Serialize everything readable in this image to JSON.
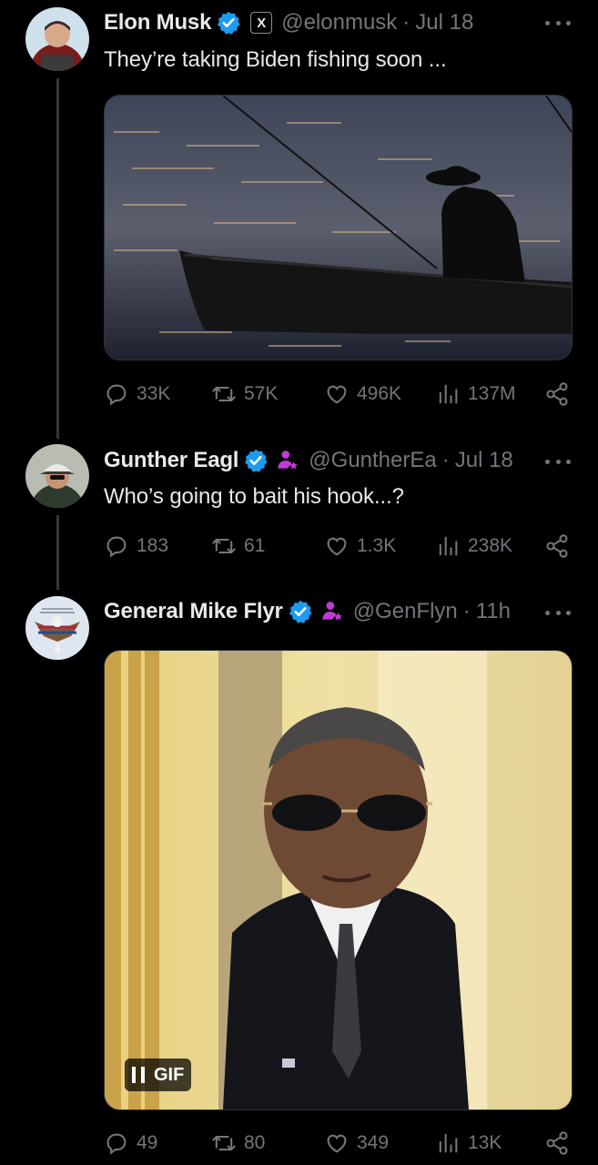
{
  "tweets": [
    {
      "author": "Elon Musk",
      "handle": "@elonmusk",
      "sep": "·",
      "time": "Jul 18",
      "text": "They’re taking Biden fishing soon ...",
      "badge_icon": "x-logo-icon",
      "stats": {
        "replies": "33K",
        "reposts": "57K",
        "likes": "496K",
        "views": "137M"
      }
    },
    {
      "author": "Gunther Eagl",
      "handle": "@GuntherEa",
      "sep": "·",
      "time": "Jul 18",
      "text": "Who’s going to bait his hook...?",
      "stats": {
        "replies": "183",
        "reposts": "61",
        "likes": "1.3K",
        "views": "238K"
      }
    },
    {
      "author": "General Mike Flyr",
      "handle": "@GenFlyn",
      "sep": "·",
      "time": "11h",
      "gif_label": "GIF",
      "stats": {
        "replies": "49",
        "reposts": "80",
        "likes": "349",
        "views": "13K"
      }
    }
  ],
  "colors": {
    "background": "#000000",
    "text": "#e7e9ea",
    "muted": "#71767b",
    "verified": "#1d9bf0",
    "affiliate": "#c13bd7"
  }
}
